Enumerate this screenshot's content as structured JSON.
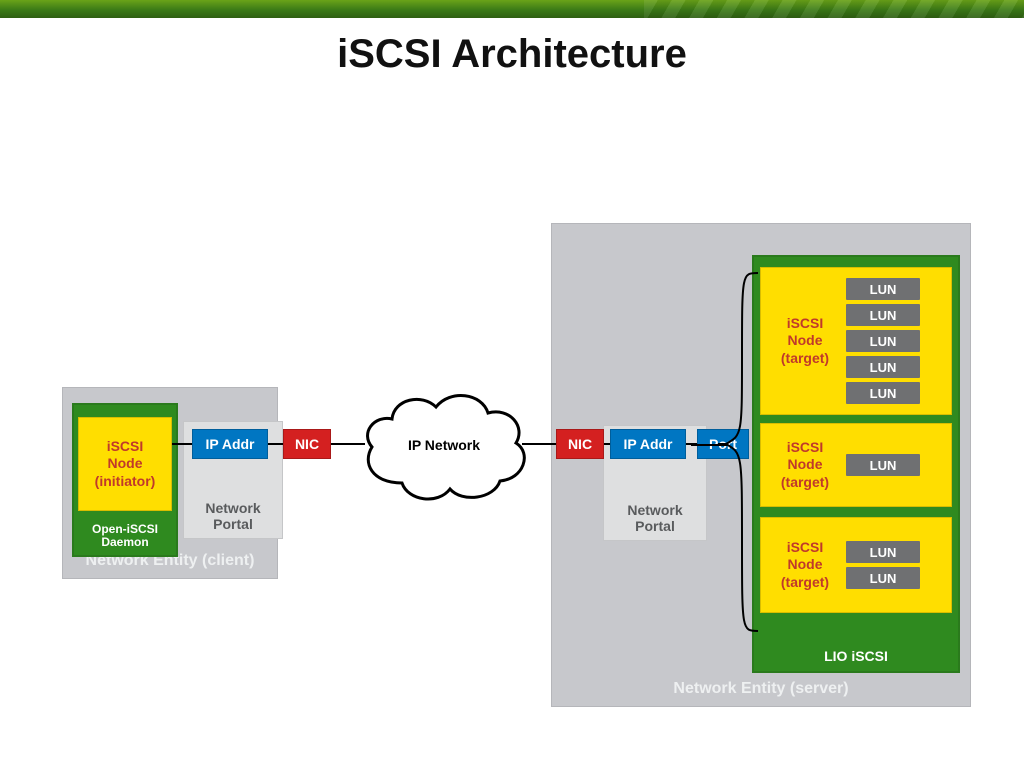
{
  "title": "iSCSI Architecture",
  "client": {
    "entity_label": "Network Entity (client)",
    "open_iscsi_label": "Open-iSCSI\nDaemon",
    "initiator_label": "iSCSI\nNode\n(initiator)",
    "portal_label": "Network\nPortal",
    "ip_addr": "IP Addr",
    "nic": "NIC"
  },
  "network": {
    "label": "IP Network"
  },
  "server": {
    "entity_label": "Network Entity (server)",
    "nic": "NIC",
    "ip_addr": "IP Addr",
    "port": "Port",
    "portal_label": "Network\nPortal",
    "lio_label": "LIO iSCSI",
    "targets": [
      {
        "label": "iSCSI\nNode\n(target)",
        "luns": [
          "LUN",
          "LUN",
          "LUN",
          "LUN",
          "LUN"
        ]
      },
      {
        "label": "iSCSI\nNode\n(target)",
        "luns": [
          "LUN"
        ]
      },
      {
        "label": "iSCSI\nNode\n(target)",
        "luns": [
          "LUN",
          "LUN"
        ]
      }
    ]
  }
}
